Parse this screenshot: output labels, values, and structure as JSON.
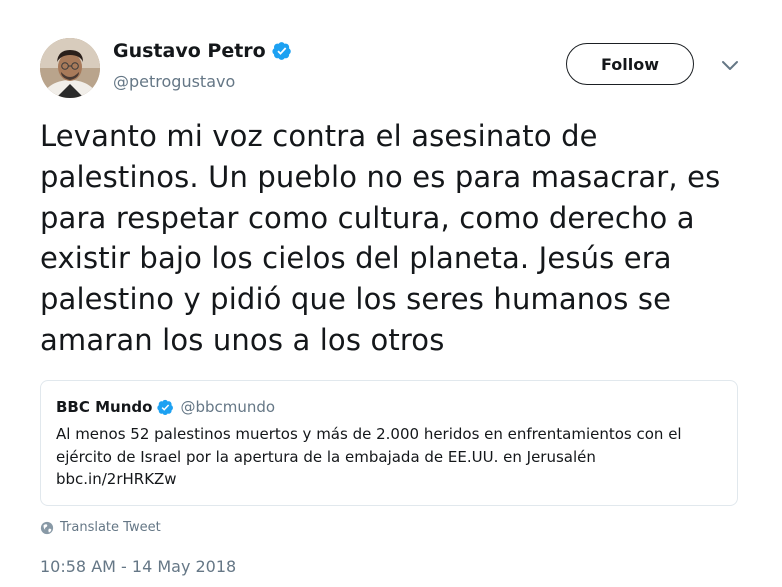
{
  "author": {
    "name": "Gustavo Petro",
    "handle": "@petrogustavo",
    "verified": true
  },
  "actions": {
    "follow_label": "Follow"
  },
  "tweet": {
    "lines": [
      "Levanto mi voz contra el asesinato de",
      "palestinos. Un pueblo no es para masacrar, es",
      "para respetar como cultura, como derecho a",
      "existir bajo los cielos del planeta. Jesús era",
      "palestino y pidió que los seres humanos se",
      "amaran los unos a los otros"
    ]
  },
  "quoted_tweet": {
    "name": "BBC Mundo",
    "handle": "@bbcmundo",
    "verified": true,
    "lines": [
      "Al menos 52 palestinos muertos y más de 2.000 heridos en enfrentamientos con el",
      "ejército de Israel por la apertura de la embajada de EE.UU. en Jerusalén",
      "bbc.in/2rHRKZw"
    ]
  },
  "translate_label": "Translate Tweet",
  "timestamp": "10:58 AM - 14 May 2018",
  "colors": {
    "verified_blue": "#1da1f2",
    "secondary_text": "#657786",
    "border": "#e1e8ed",
    "text": "#14171a"
  },
  "icons": {
    "verified": "verified-badge-icon",
    "caret": "chevron-down-icon",
    "translate": "globe-icon"
  }
}
